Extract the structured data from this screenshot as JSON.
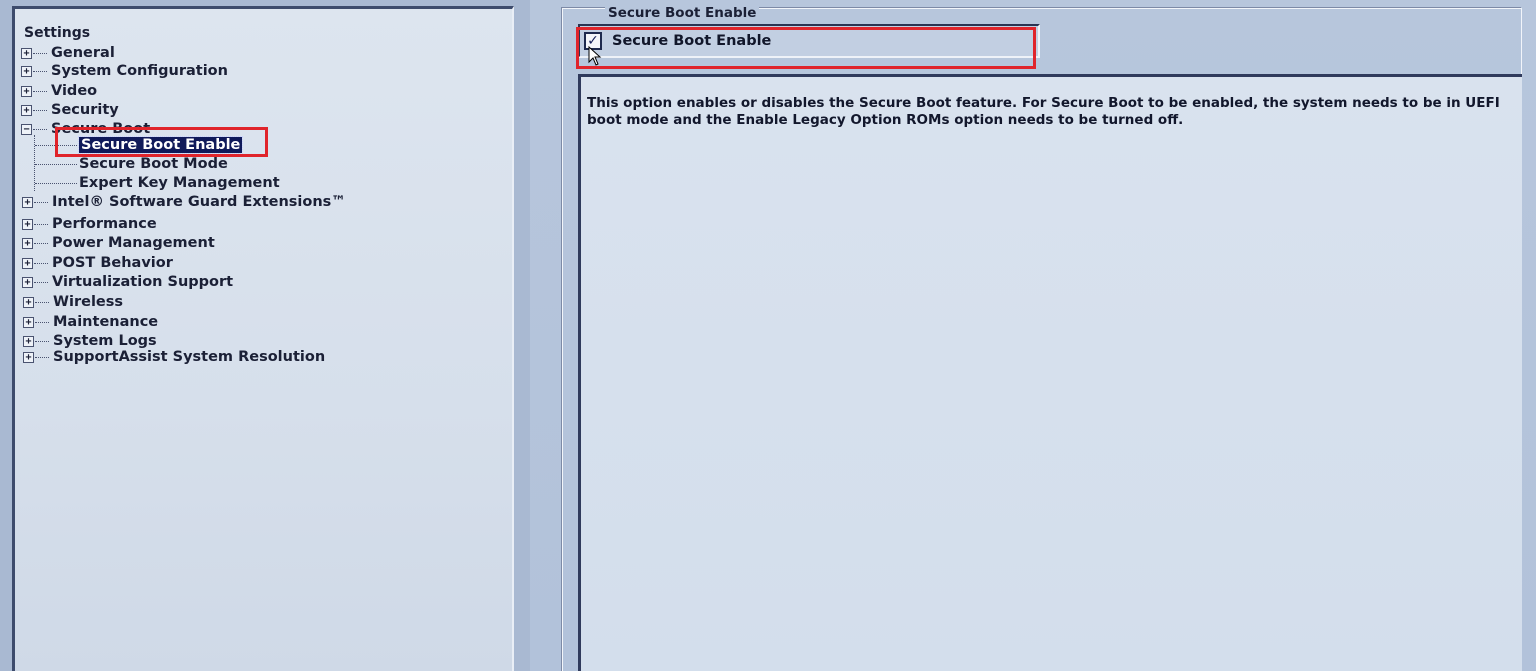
{
  "tree": {
    "root_label": "Settings",
    "items": [
      {
        "label": "General",
        "expander": "+"
      },
      {
        "label": "System Configuration",
        "expander": "+"
      },
      {
        "label": "Video",
        "expander": "+"
      },
      {
        "label": "Security",
        "expander": "+"
      },
      {
        "label": "Secure Boot",
        "expander": "−"
      },
      {
        "label": "Intel® Software Guard Extensions™",
        "expander": "+"
      },
      {
        "label": "Performance",
        "expander": "+"
      },
      {
        "label": "Power Management",
        "expander": "+"
      },
      {
        "label": "POST Behavior",
        "expander": "+"
      },
      {
        "label": "Virtualization Support",
        "expander": "+"
      },
      {
        "label": "Wireless",
        "expander": "+"
      },
      {
        "label": "Maintenance",
        "expander": "+"
      },
      {
        "label": "System Logs",
        "expander": "+"
      },
      {
        "label": "SupportAssist System Resolution",
        "expander": "+"
      }
    ],
    "secure_boot_children": [
      {
        "label": "Secure Boot Enable",
        "selected": true
      },
      {
        "label": "Secure Boot Mode",
        "selected": false
      },
      {
        "label": "Expert Key Management",
        "selected": false
      }
    ]
  },
  "content": {
    "group_title": "Secure Boot Enable",
    "checkbox": {
      "label": "Secure Boot Enable",
      "checked": true,
      "mark": "✓"
    },
    "description": "This option enables or disables the Secure Boot feature. For Secure Boot to be enabled, the system needs to be in UEFI boot mode and the Enable Legacy Option ROMs option needs to be turned off."
  },
  "colors": {
    "highlight_box": "#e0242b",
    "selection_bg": "#101a5a"
  }
}
